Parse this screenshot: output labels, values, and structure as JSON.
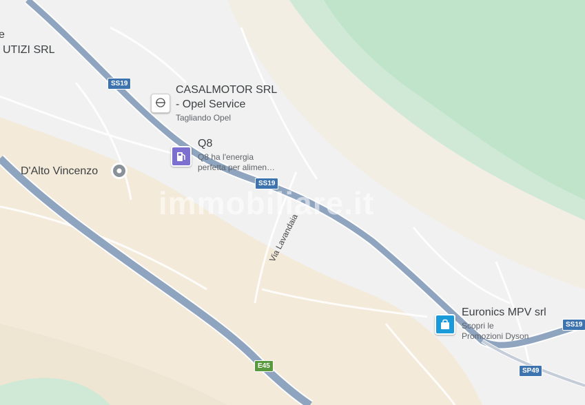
{
  "map": {
    "roads": [
      {
        "label": "SS19"
      },
      {
        "label": "SS19"
      },
      {
        "label": "SS19"
      },
      {
        "label": "E45"
      },
      {
        "label": "SP49"
      }
    ],
    "street_label": "Via Lavandaia",
    "watermark": "immobiliare.it",
    "pois": [
      {
        "title": "UTIZI SRL",
        "subtitle": ""
      },
      {
        "title": "CASALMOTOR SRL",
        "title2": "- Opel Service",
        "subtitle": "Tagliando Opel",
        "icon": "opel-logo-icon",
        "icon_text": "OPEL"
      },
      {
        "title": "Q8",
        "subtitle": "Q8 ha l'energia",
        "subtitle2": "perfetta per alimen…",
        "icon": "fuel-pump-icon",
        "color": "#7b6fcf"
      },
      {
        "title": "D'Alto Vincenzo",
        "icon": "place-marker-icon"
      },
      {
        "title": "Euronics MPV srl",
        "subtitle": "Scopri le",
        "subtitle2": "Promozioni Dyson",
        "icon": "shopping-bag-icon",
        "color": "#1a9ad9"
      }
    ],
    "partial_label": "e"
  }
}
